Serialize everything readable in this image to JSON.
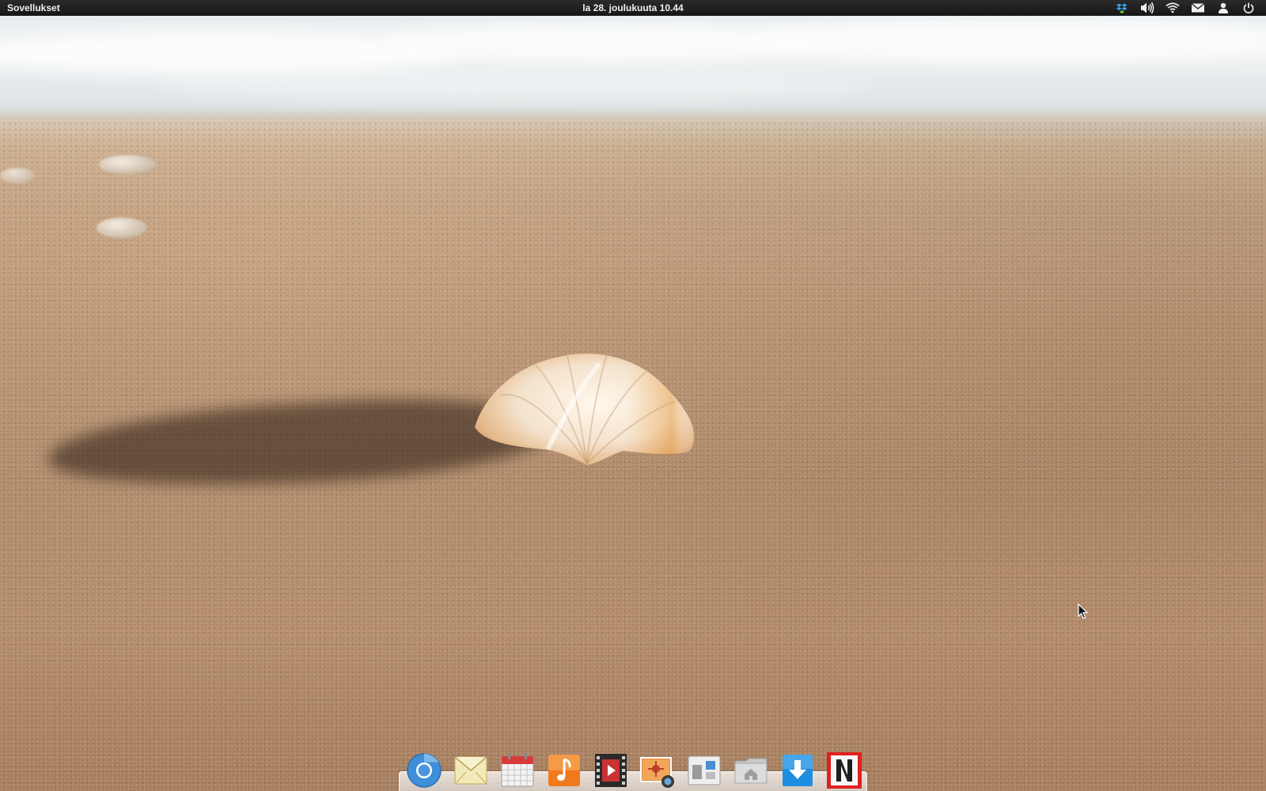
{
  "top_panel": {
    "apps_menu_label": "Sovellukset",
    "clock": "la 28. joulukuuta 10.44",
    "indicators": [
      {
        "name": "dropbox-icon"
      },
      {
        "name": "volume-icon"
      },
      {
        "name": "wifi-icon"
      },
      {
        "name": "mail-icon"
      },
      {
        "name": "user-icon"
      },
      {
        "name": "power-icon"
      }
    ]
  },
  "dock": {
    "items": [
      {
        "name": "chromium-browser",
        "icon": "chrome-icon"
      },
      {
        "name": "mail",
        "icon": "mail-icon"
      },
      {
        "name": "calendar",
        "icon": "calendar-icon"
      },
      {
        "name": "music",
        "icon": "music-icon"
      },
      {
        "name": "videos",
        "icon": "video-icon"
      },
      {
        "name": "photos",
        "icon": "photos-icon"
      },
      {
        "name": "switchboard",
        "icon": "settings-icon"
      },
      {
        "name": "files",
        "icon": "home-folder-icon"
      },
      {
        "name": "software-center",
        "icon": "download-icon"
      },
      {
        "name": "netflix",
        "icon": "netflix-icon"
      }
    ]
  },
  "colors": {
    "panel_bg": "#1e1e1e",
    "panel_text": "#f0f0f0",
    "music_orange": "#f07a1c",
    "download_blue": "#1e8fe0",
    "netflix_red": "#e02020"
  }
}
